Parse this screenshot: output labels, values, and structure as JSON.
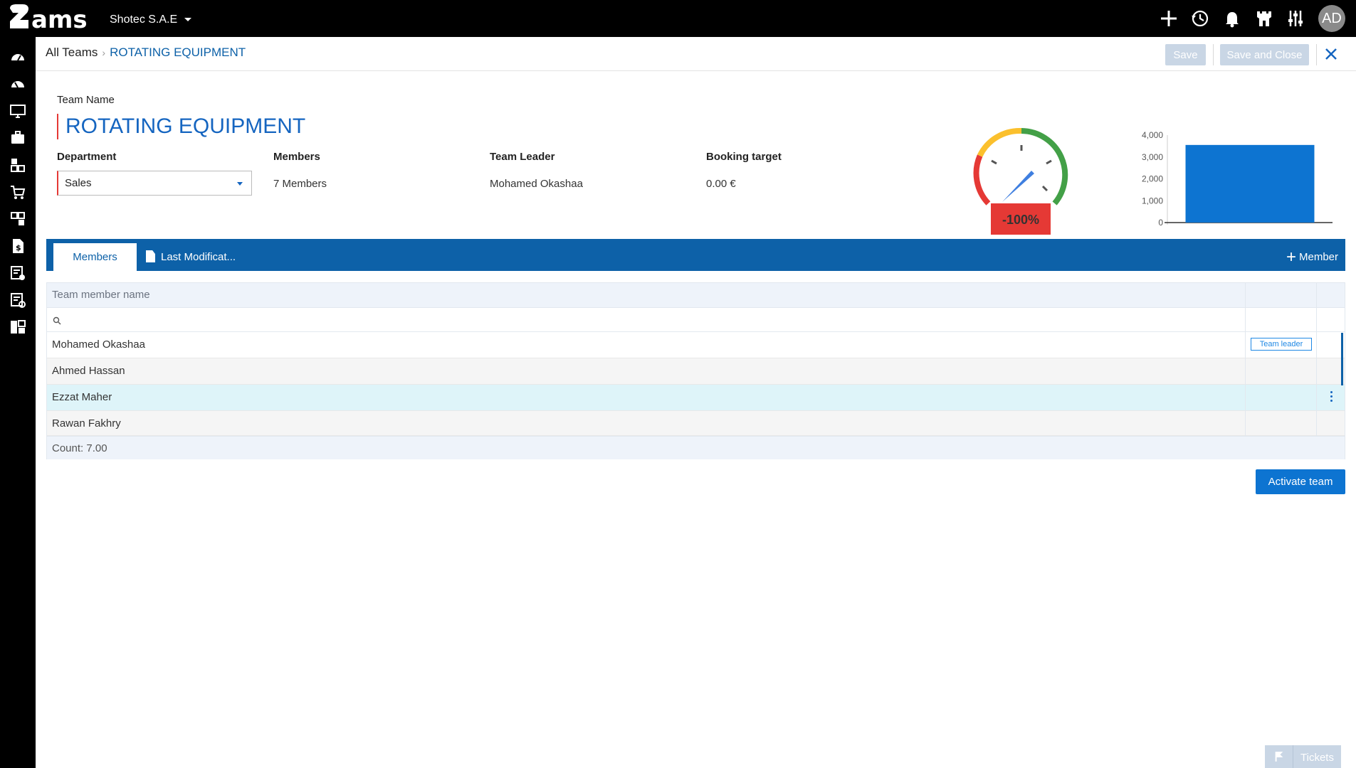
{
  "app": {
    "company": "Shotec S.A.E",
    "user_initials": "AD"
  },
  "breadcrumb": {
    "root": "All Teams",
    "current": "ROTATING EQUIPMENT"
  },
  "toolbar": {
    "save_label": "Save",
    "save_close_label": "Save and Close"
  },
  "team": {
    "name_label": "Team Name",
    "name": "ROTATING EQUIPMENT",
    "department_label": "Department",
    "department": "Sales",
    "members_label": "Members",
    "members": "7 Members",
    "leader_label": "Team Leader",
    "leader": "Mohamed Okashaa",
    "booking_label": "Booking target",
    "booking": "0.00 €"
  },
  "gauge": {
    "value_label": "-100%",
    "colors": [
      "#e53935",
      "#fbc02d",
      "#43a047"
    ]
  },
  "chart_data": {
    "type": "bar",
    "categories": [
      ""
    ],
    "values": [
      3550
    ],
    "ylim": [
      0,
      4000
    ],
    "yticks": [
      "4,000",
      "3,000",
      "2,000",
      "1,000",
      "0"
    ],
    "color": "#0d74d1"
  },
  "tabs": {
    "members": "Members",
    "last_modification": "Last Modificat...",
    "add_member": "Member"
  },
  "grid": {
    "column_header": "Team member name",
    "rows": [
      {
        "name": "Mohamed Okashaa",
        "badge": "Team leader"
      },
      {
        "name": "Ahmed Hassan"
      },
      {
        "name": "Ezzat Maher"
      },
      {
        "name": "Rawan Fakhry"
      }
    ],
    "footer": "Count: 7.00"
  },
  "actions": {
    "activate": "Activate team"
  },
  "tickets": {
    "label": "Tickets"
  }
}
